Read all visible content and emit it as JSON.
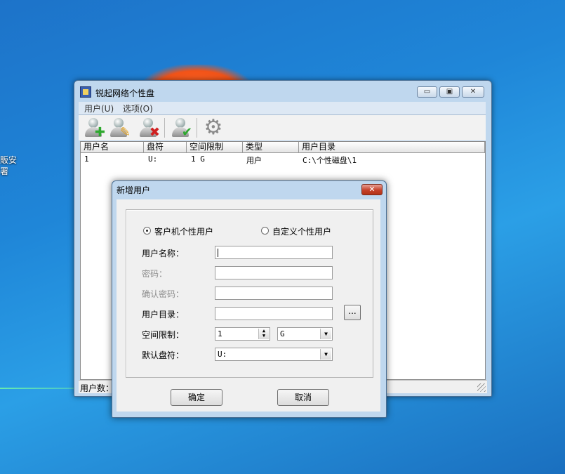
{
  "desktop": {
    "text": "販安\n署"
  },
  "main_window": {
    "title": "锐起网络个性盘",
    "caption_buttons": {
      "minimize": "▭",
      "maximize": "▣",
      "close": "✕"
    },
    "menu": [
      {
        "label": "用户(U)"
      },
      {
        "label": "选项(O)"
      }
    ],
    "toolbar": [
      {
        "icon": "add-user-icon"
      },
      {
        "icon": "edit-user-icon"
      },
      {
        "icon": "delete-user-icon"
      },
      {
        "icon": "user-ok-icon"
      },
      {
        "icon": "gear-icon"
      }
    ],
    "list": {
      "columns": [
        "用户名",
        "盘符",
        "空间限制",
        "类型",
        "用户目录"
      ],
      "rows": [
        [
          "1",
          "U:",
          "1 G",
          "用户",
          "C:\\个性磁盘\\1"
        ]
      ]
    },
    "status": "用户数："
  },
  "dialog": {
    "title": "新增用户",
    "close_label": "✕",
    "radio_client": {
      "label": "客户机个性用户",
      "checked": true
    },
    "radio_custom": {
      "label": "自定义个性用户",
      "checked": false
    },
    "username_label": "用户名称：",
    "username_value": "",
    "password_label": "密码：",
    "password_value": "",
    "confirm_label": "确认密码：",
    "confirm_value": "",
    "directory_label": "用户目录：",
    "directory_value": "",
    "browse_label": "...",
    "space_label": "空间限制：",
    "space_value": "1",
    "space_unit": "G",
    "drive_label": "默认盘符：",
    "drive_value": "U:",
    "ok_label": "确定",
    "cancel_label": "取消"
  }
}
